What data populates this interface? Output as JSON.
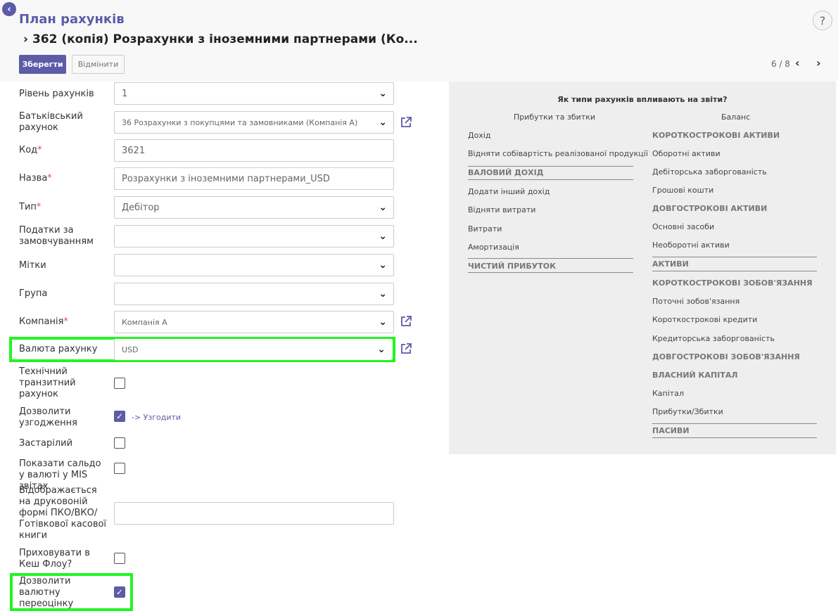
{
  "header": {
    "app_title": "План рахунків",
    "record_title": "362 (копія) Розрахунки з іноземними партнерами (Ко...",
    "save_label": "Зберегти",
    "cancel_label": "Відмінити",
    "pager": "6 / 8",
    "help": "?"
  },
  "form": {
    "level_label": "Рівень рахунків",
    "level_value": "1",
    "parent_label": "Батьківський рахунок",
    "parent_value": "36 Розрахунки з покупцями та замовниками (Компанія А)",
    "code_label": "Код",
    "code_value": "3621",
    "name_label": "Назва",
    "name_value": "Розрахунки з іноземними партнерами_USD",
    "type_label": "Тип",
    "type_value": "Дебітор",
    "taxes_label": "Податки за замовчуванням",
    "taxes_value": "",
    "tags_label": "Мітки",
    "tags_value": "",
    "group_label": "Група",
    "group_value": "",
    "company_label": "Компанія",
    "company_value": "Компанія А",
    "currency_label": "Валюта рахунку",
    "currency_value": "USD",
    "transit_label": "Технічний транзитний рахунок",
    "reconcile_label": "Дозволити узгодження",
    "reconcile_link": "-> Узгодити",
    "deprecated_label": "Застарілий",
    "mis_label": "Показати сальдо у валюті у MIS звітах",
    "cash_label": "Відображається на друковоній формі ПКО/ВКО/ Готівкової касової книги",
    "cash_value": "",
    "hide_cashflow_label": "Приховувати в Кеш Флоу?",
    "revaluation_label": "Дозволити валютну переоцінку",
    "required_mark": "*"
  },
  "panel": {
    "title": "Як типи рахунків впливають на звіти?",
    "pl_header": "Прибутки та збитки",
    "bs_header": "Баланс",
    "pl_income": "Дохід",
    "pl_cogs": "Відняти собівартість реалізованої продукції",
    "pl_gross": "ВАЛОВИЙ ДОХІД",
    "pl_other_income": "Додати інший дохід",
    "pl_sub_expenses": "Відняти витрати",
    "pl_expenses": "Витрати",
    "pl_depreciation": "Амортизація",
    "pl_net": "ЧИСТИЙ ПРИБУТОК",
    "bs_current_assets": "КОРОТКОСТРОКОВІ АКТИВИ",
    "bs_working": "Оборотні активи",
    "bs_receivable": "Дебіторська заборгованість",
    "bs_cash": "Грошові кошти",
    "bs_noncurrent_assets": "ДОВГОСТРОКОВІ АКТИВИ",
    "bs_fixed": "Основні засоби",
    "bs_noncurrent": "Необоротні активи",
    "bs_assets": "АКТИВИ",
    "bs_current_liab": "КОРОТКОСТРОКОВІ ЗОБОВ'ЯЗАННЯ",
    "bs_current_liab_item": "Поточні зобов'язання",
    "bs_short_credit": "Короткострокові кредити",
    "bs_payable": "Кредиторська заборгованість",
    "bs_long_liab": "ДОВГОСТРОКОВІ ЗОБОВ'ЯЗАННЯ",
    "bs_equity_h": "ВЛАСНИЙ КАПІТАЛ",
    "bs_capital": "Капітал",
    "bs_pl": "Прибутки/Збитки",
    "bs_liabilities": "ПАСИВИ"
  },
  "colors": {
    "accent": "#5b5ba8",
    "highlight": "#22f522",
    "required": "#d9534f",
    "panel_bg": "#eeeeee"
  }
}
